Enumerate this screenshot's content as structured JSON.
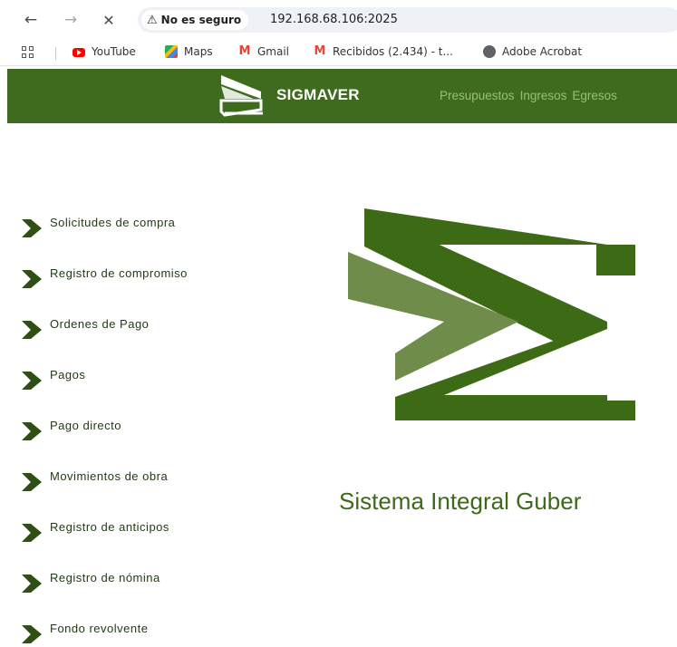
{
  "browser": {
    "security_label": "No es seguro",
    "url": "192.168.68.106:2025",
    "bookmarks": [
      {
        "label": "YouTube",
        "icon": "youtube-icon"
      },
      {
        "label": "Maps",
        "icon": "maps-icon"
      },
      {
        "label": "Gmail",
        "icon": "gmail-icon"
      },
      {
        "label": "Recibidos (2.434) - t...",
        "icon": "gmail-icon"
      },
      {
        "label": "Adobe Acrobat",
        "icon": "acrobat-icon"
      }
    ]
  },
  "header": {
    "brand": "SIGMAVER",
    "nav": [
      "Presupuestos",
      "Ingresos",
      "Egresos"
    ],
    "bg_color": "#3e6b1e",
    "nav_color": "#97c072"
  },
  "sidebar": {
    "items": [
      {
        "label": "Solicitudes de compra"
      },
      {
        "label": "Registro de compromiso"
      },
      {
        "label": "Ordenes de Pago"
      },
      {
        "label": "Pagos"
      },
      {
        "label": "Pago directo"
      },
      {
        "label": "Movimientos de obra"
      },
      {
        "label": "Registro de anticipos"
      },
      {
        "label": "Registro de nómina"
      },
      {
        "label": "Fondo revolvente"
      }
    ]
  },
  "main": {
    "tagline": "Sistema Integral Guber",
    "accent_dark": "#3d6a15",
    "accent_light": "#6f8c4a"
  }
}
